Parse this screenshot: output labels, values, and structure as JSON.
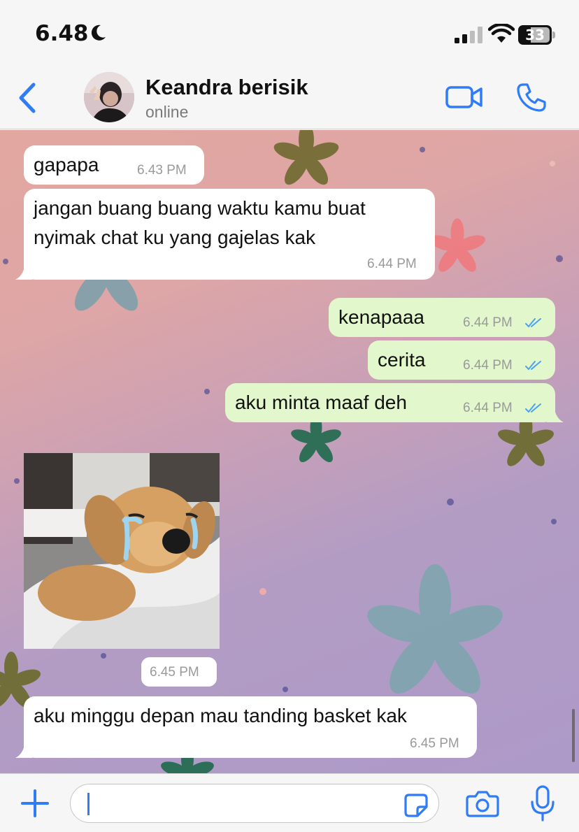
{
  "status_bar": {
    "time": "6.48",
    "battery": "33"
  },
  "header": {
    "contact_name": "Keandra berisik",
    "contact_status": "online"
  },
  "messages": [
    {
      "side": "in",
      "text": "gapapa",
      "time": "6.43 PM"
    },
    {
      "side": "in",
      "line1": "jangan buang buang waktu kamu buat",
      "line2": "nyimak chat ku yang gajelas kak",
      "time": "6.44 PM"
    },
    {
      "side": "out",
      "text": "kenapaaa",
      "time": "6.44 PM",
      "status": "read"
    },
    {
      "side": "out",
      "text": "cerita",
      "time": "6.44 PM",
      "status": "read"
    },
    {
      "side": "out",
      "text": "aku minta maaf deh",
      "time": "6.44 PM",
      "status": "read"
    },
    {
      "side": "in",
      "type": "image",
      "image_description": "crying golden retriever sticker",
      "time": "6.45 PM"
    },
    {
      "side": "in",
      "text": "aku minggu depan mau tanding basket kak",
      "time": "6.45 PM"
    }
  ],
  "input": {
    "value": ""
  },
  "colors": {
    "accent": "#2f7cf6",
    "outgoing_bubble": "#e2f7cb",
    "incoming_bubble": "#ffffff",
    "read_ticks": "#4aa3f0"
  },
  "icons": [
    "moon-icon",
    "signal-icon",
    "wifi-icon",
    "battery-icon",
    "back-chevron-icon",
    "video-call-icon",
    "phone-icon",
    "plus-icon",
    "sticker-icon",
    "camera-icon",
    "microphone-icon",
    "double-check-icon"
  ]
}
